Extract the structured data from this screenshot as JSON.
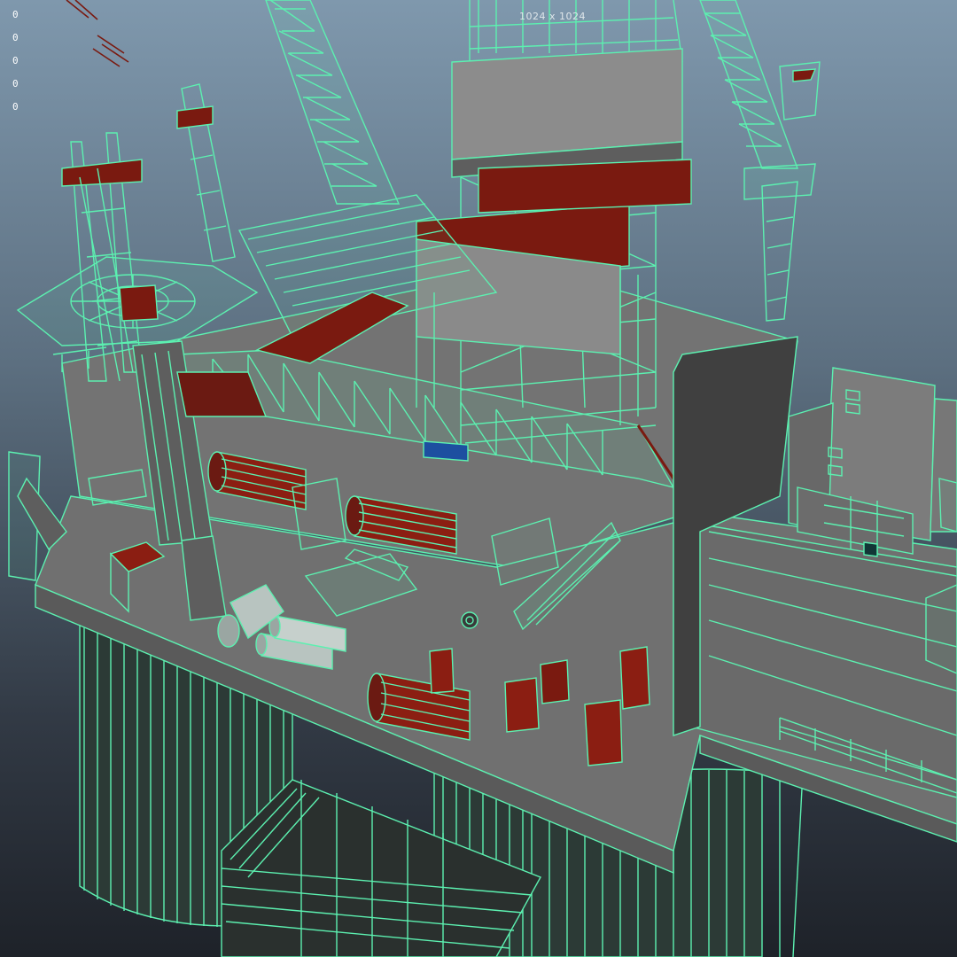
{
  "viewport": {
    "camera": "persp",
    "display_mode": "wireframe-on-shaded",
    "resolution_gate_label": "1024 x 1024",
    "resolution_gate_bottom_label": "‑ ‑ ‑",
    "hud_stats": [
      "0",
      "0",
      "0",
      "0",
      "0"
    ]
  },
  "colors": {
    "bg_top": "#7f98ad",
    "bg_bottom": "#1e2229",
    "wire": "#5cf0b0",
    "deck": "#747474",
    "dark_red": "#7a1a10",
    "blue_accent": "#1d4fa0",
    "hud_text": "#ffffff"
  },
  "model": {
    "name": "offshore-oil-platform",
    "components": [
      "derrick-tower",
      "lattice-crane-boom",
      "flare-stack",
      "helideck",
      "pressure-vessels",
      "support-columns",
      "accommodation-module",
      "pontoon"
    ]
  }
}
